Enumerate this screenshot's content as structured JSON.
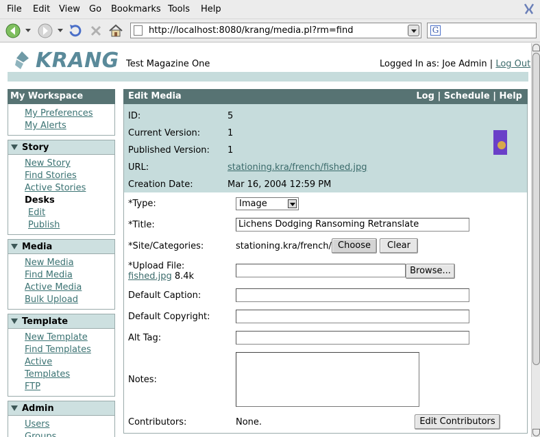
{
  "browser": {
    "menu": [
      "File",
      "Edit",
      "View",
      "Go",
      "Bookmarks",
      "Tools",
      "Help"
    ],
    "url": "http://localhost:8080/krang/media.pl?rm=find",
    "search_value": ""
  },
  "header": {
    "logo": "KRANG",
    "site_name": "Test Magazine One",
    "logged_in_as": "Logged In as: Joe Admin |",
    "logout": "Log Out"
  },
  "sidebar": {
    "title": "My Workspace",
    "workspace_links": [
      "My Preferences",
      "My Alerts"
    ],
    "sections": [
      {
        "title": "Story",
        "items": [
          {
            "label": "New Story",
            "type": "link"
          },
          {
            "label": "Find Stories",
            "type": "link"
          },
          {
            "label": "Active Stories",
            "type": "link"
          },
          {
            "label": "Desks",
            "type": "label"
          },
          {
            "label": "Edit",
            "type": "sublink"
          },
          {
            "label": "Publish",
            "type": "sublink"
          }
        ]
      },
      {
        "title": "Media",
        "items": [
          {
            "label": "New Media",
            "type": "link"
          },
          {
            "label": "Find Media",
            "type": "link"
          },
          {
            "label": "Active Media",
            "type": "link"
          },
          {
            "label": "Bulk Upload",
            "type": "link"
          }
        ]
      },
      {
        "title": "Template",
        "items": [
          {
            "label": "New Template",
            "type": "link"
          },
          {
            "label": "Find Templates",
            "type": "link"
          },
          {
            "label": "Active",
            "type": "link"
          },
          {
            "label": "Templates",
            "type": "link"
          },
          {
            "label": "FTP",
            "type": "link"
          }
        ]
      },
      {
        "title": "Admin",
        "items": [
          {
            "label": "Users",
            "type": "link"
          },
          {
            "label": "Groups",
            "type": "link"
          }
        ]
      }
    ]
  },
  "main": {
    "title": "Edit Media",
    "header_links": [
      "Log",
      "Schedule",
      "Help"
    ],
    "info": {
      "id_label": "ID:",
      "id_value": "5",
      "current_version_label": "Current Version:",
      "current_version_value": "1",
      "published_version_label": "Published Version:",
      "published_version_value": "1",
      "url_label": "URL:",
      "url_value": "stationing.kra/french/fished.jpg",
      "creation_date_label": "Creation Date:",
      "creation_date_value": "Mar 16, 2004 12:59 PM"
    },
    "form": {
      "type_label": "*Type:",
      "type_value": "Image",
      "title_label": "*Title:",
      "title_value": "Lichens Dodging Ransoming Retranslate",
      "site_label": "*Site/Categories:",
      "site_value": "stationing.kra/french/",
      "choose_button": "Choose",
      "clear_button": "Clear",
      "upload_label": "*Upload File:",
      "upload_file_link": "fished.jpg",
      "upload_file_size": "8.4k",
      "browse_button": "Browse...",
      "caption_label": "Default Caption:",
      "caption_value": "",
      "copyright_label": "Default Copyright:",
      "copyright_value": "",
      "alt_label": "Alt Tag:",
      "alt_value": "",
      "notes_label": "Notes:",
      "contributors_label": "Contributors:",
      "contributors_value": "None.",
      "edit_contributors_button": "Edit Contributors"
    }
  }
}
